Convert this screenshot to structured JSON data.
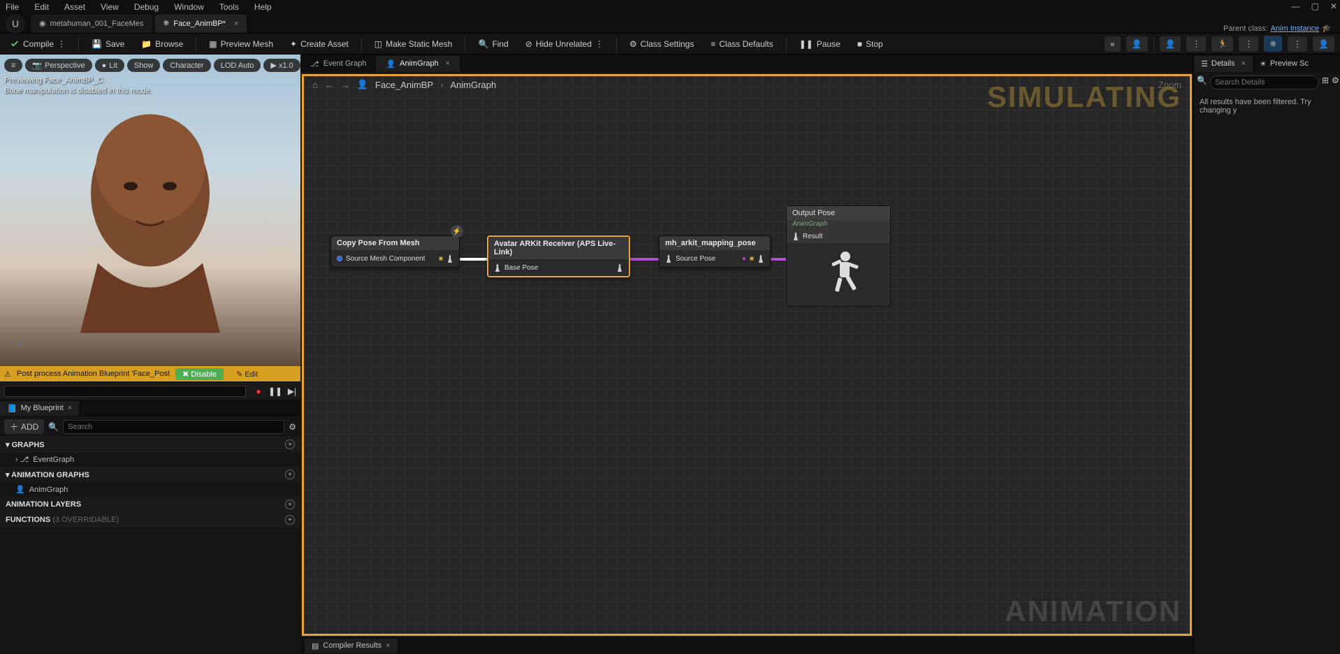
{
  "menubar": [
    "File",
    "Edit",
    "Asset",
    "View",
    "Debug",
    "Window",
    "Tools",
    "Help"
  ],
  "doc_tabs": [
    {
      "label": "metahuman_001_FaceMes",
      "active": false
    },
    {
      "label": "Face_AnimBP*",
      "active": true
    }
  ],
  "parent_class": {
    "label": "Parent class:",
    "link": "Anim Instance"
  },
  "toolbar": {
    "compile": "Compile",
    "save": "Save",
    "browse": "Browse",
    "preview_mesh": "Preview Mesh",
    "create_asset": "Create Asset",
    "make_static_mesh": "Make Static Mesh",
    "find": "Find",
    "hide_unrelated": "Hide Unrelated",
    "class_settings": "Class Settings",
    "class_defaults": "Class Defaults",
    "pause": "Pause",
    "stop": "Stop"
  },
  "viewport": {
    "chips": [
      "≡",
      "Perspective",
      "Lit",
      "Show",
      "Character",
      "LOD Auto",
      "▶ x1.0"
    ],
    "overlay_line1": "Previewing Face_AnimBP_C.",
    "overlay_line2": "Bone manipulation is disabled in this mode.",
    "axis": "Z",
    "warn_text": "Post process Animation Blueprint 'Face_Post",
    "warn_disable": "Disable",
    "warn_edit": "Edit"
  },
  "my_blueprint": {
    "tab": "My Blueprint",
    "add": "ADD",
    "search_placeholder": "Search",
    "sections": {
      "graphs": "GRAPHS",
      "event_graph": "EventGraph",
      "anim_graphs": "ANIMATION GRAPHS",
      "anim_graph": "AnimGraph",
      "anim_layers": "ANIMATION LAYERS",
      "functions": "FUNCTIONS",
      "functions_sub": "(3 OVERRIDABLE)"
    }
  },
  "graph": {
    "tabs": [
      {
        "label": "Event Graph",
        "active": false
      },
      {
        "label": "AnimGraph",
        "active": true
      }
    ],
    "breadcrumb": {
      "root": "Face_AnimBP",
      "leaf": "AnimGraph",
      "zoom": "Zoom"
    },
    "big_sim": "SIMULATING",
    "big_anim": "ANIMATION",
    "nodes": {
      "n1": {
        "title": "Copy Pose From Mesh",
        "pin_in": "Source Mesh Component"
      },
      "n2": {
        "title": "Avatar ARKit Receiver (APS Live-Link)",
        "pin_in": "Base Pose"
      },
      "n3": {
        "title": "mh_arkit_mapping_pose",
        "pin_in": "Source Pose"
      },
      "n4": {
        "title": "Output Pose",
        "sub": "AnimGraph",
        "pin_in": "Result"
      }
    }
  },
  "compiler": {
    "tab": "Compiler Results"
  },
  "details": {
    "tab": "Details",
    "preview": "Preview Sc",
    "search_placeholder": "Search Details",
    "msg": "All results have been filtered. Try changing y"
  }
}
